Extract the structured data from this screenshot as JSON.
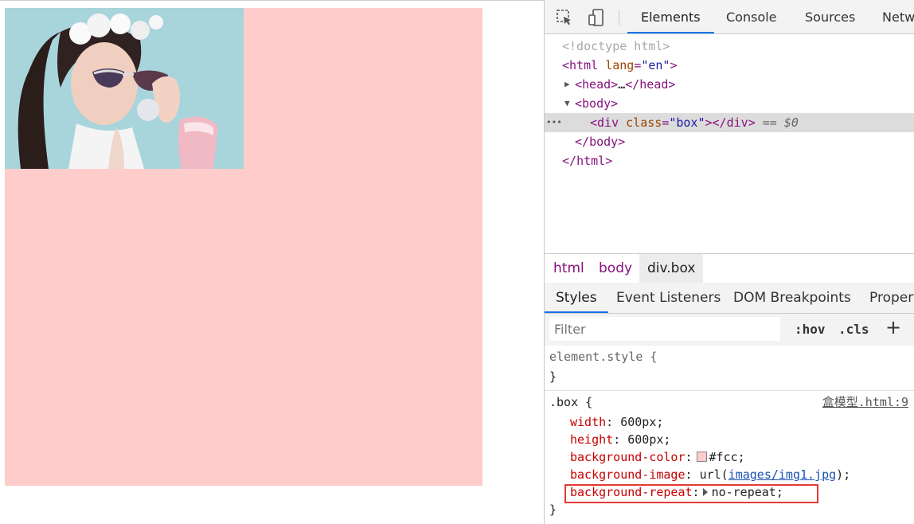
{
  "devtools": {
    "tabs": [
      "Elements",
      "Console",
      "Sources",
      "Netw"
    ],
    "dom": {
      "doctype": "<!doctype html>",
      "html_open_tag": "html",
      "html_attr_name": "lang",
      "html_attr_value": "\"en\"",
      "head_tag": "head",
      "head_collapsed": "…",
      "body_tag": "body",
      "div_tag": "div",
      "div_attr_name": "class",
      "div_attr_value": "\"box\"",
      "selected_marker": "== $0",
      "row_dots": "•••"
    },
    "breadcrumb": [
      "html",
      "body",
      "div.box"
    ],
    "sub_tabs": [
      "Styles",
      "Event Listeners",
      "DOM Breakpoints",
      "Propert"
    ],
    "filter": {
      "placeholder": "Filter",
      "hov": ":hov",
      "cls": ".cls",
      "plus": "+"
    },
    "styles": {
      "element_style_selector": "element.style {",
      "close_brace": "}",
      "box_selector": ".box {",
      "source_link": "盒模型.html:9",
      "declarations": [
        {
          "prop": "width",
          "value": "600px;"
        },
        {
          "prop": "height",
          "value": "600px;"
        },
        {
          "prop": "background-color",
          "value": "#fcc;"
        },
        {
          "prop": "background-image",
          "value_prefix": "url(",
          "link": "images/img1.jpg",
          "value_suffix": ");"
        },
        {
          "prop": "background-repeat",
          "value": "no-repeat;"
        }
      ]
    }
  },
  "colors": {
    "box_background": "#ffcccc",
    "highlight_border": "#e53935",
    "active_tab_underline": "#1a73e8"
  }
}
